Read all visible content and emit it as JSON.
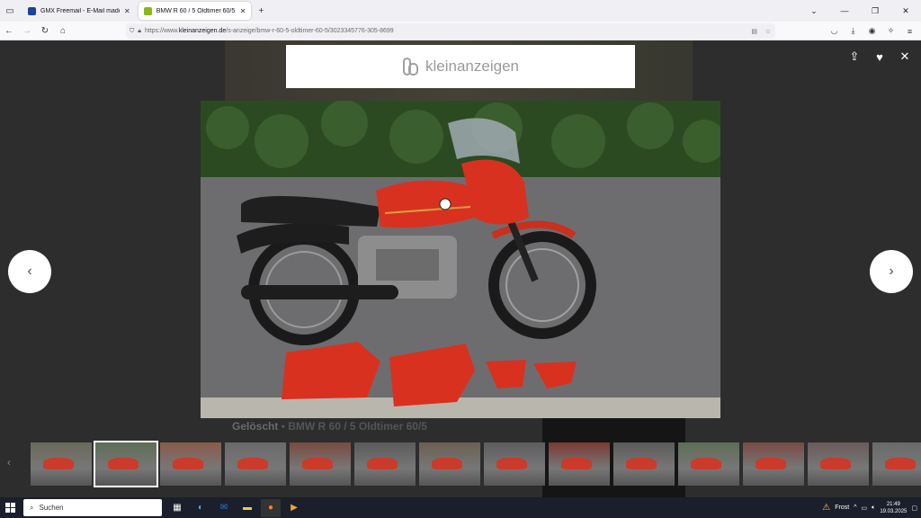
{
  "tabs": [
    {
      "label": "GMX Freemail - E-Mail made in",
      "active": false,
      "favicon_color": "#1c449b",
      "favicon_text": "GMX"
    },
    {
      "label": "BMW R 60 / 5 Oldtimer 60/5 in",
      "active": true,
      "favicon_color": "#86b817"
    }
  ],
  "new_tab_label": "+",
  "url": {
    "prefix": "https://www.",
    "domain": "kleinanzeigen.de",
    "path": "/s-anzeige/bmw-r-60-5-oldtimer-60-5/3023345776-305-8699"
  },
  "logo_text": "kleinanzeigen",
  "caption": {
    "deleted": "Gelöscht",
    "separator": " • ",
    "title": "BMW R 60 / 5 Oldtimer 60/5"
  },
  "thumbnail_count": 14,
  "active_thumbnail": 2,
  "taskbar": {
    "search_placeholder": "Suchen",
    "weather": "Frost",
    "time": "21:49",
    "date": "19.03.2025"
  },
  "colors": {
    "accent_red": "#d9311f",
    "brand_green": "#86b817"
  }
}
